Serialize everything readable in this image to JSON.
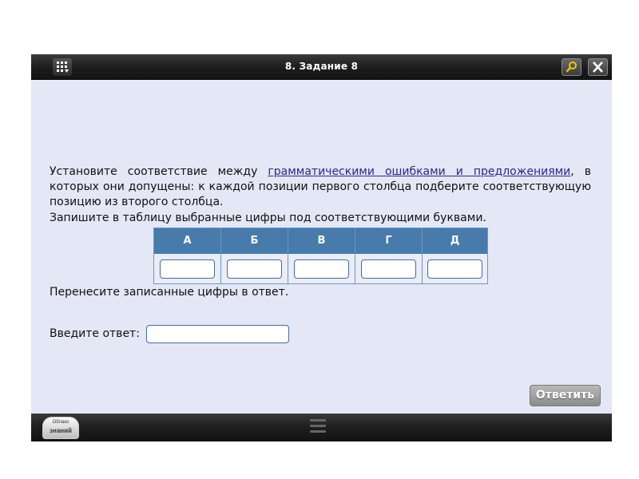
{
  "window": {
    "title": "8. Задание 8",
    "menu_icon": "grid-menu-icon",
    "search_icon": "search-icon",
    "close_icon": "close-icon"
  },
  "task": {
    "instruction_before_link": "Установите соответствие между ",
    "instruction_link": "грамматическими ошибками и предложениями",
    "instruction_after_link": ", в которых они допущены: к каждой позиции первого столбца подберите соответствующую позицию из второго столбца.",
    "table_instruction": "Запишите в таблицу выбранные цифры под соответствующими буквами.",
    "table": {
      "headers": [
        "А",
        "Б",
        "В",
        "Г",
        "Д"
      ],
      "values": [
        "",
        "",
        "",
        "",
        ""
      ]
    },
    "transfer_instruction": "Перенесите записанные цифры в ответ.",
    "answer_label": "Введите ответ:",
    "answer_value": "",
    "submit_label": "Ответить"
  },
  "footer": {
    "logo_text_top": "Облако",
    "logo_text_bottom": "знаний",
    "handle_icon": "drag-handle-icon"
  },
  "colors": {
    "titlebar": "#1c1c1c",
    "content_bg": "#e4e7f5",
    "table_header": "#467bac",
    "link": "#28278f",
    "submit_button": "#a3a3a3"
  }
}
